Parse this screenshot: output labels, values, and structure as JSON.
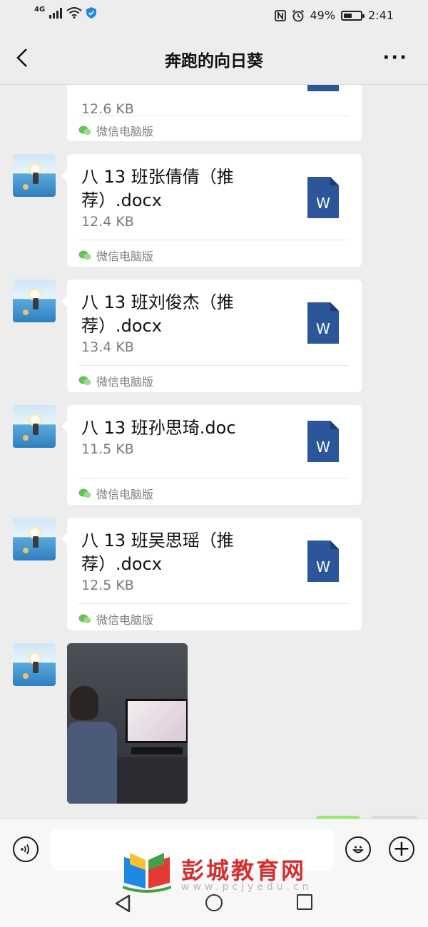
{
  "status_bar": {
    "network": "4G",
    "battery_percent": "49%",
    "time": "2:41",
    "battery_level": 0.49
  },
  "header": {
    "title": "奔跑的向日葵",
    "back_icon": "chevron-left-icon",
    "more_icon": "more-dots-icon",
    "more_label": "···"
  },
  "messages": [
    {
      "type": "file",
      "name": "",
      "size": "12.6 KB",
      "source": "微信电脑版",
      "icon": "word-doc-icon",
      "partial": true
    },
    {
      "type": "file",
      "name": "八 13 班张倩倩（推荐）.docx",
      "size": "12.4 KB",
      "source": "微信电脑版",
      "icon": "word-doc-icon"
    },
    {
      "type": "file",
      "name": "八 13 班刘俊杰（推荐）.docx",
      "size": "13.4 KB",
      "source": "微信电脑版",
      "icon": "word-doc-icon"
    },
    {
      "type": "file",
      "name": "八 13 班孙思琦.doc",
      "size": "11.5 KB",
      "source": "微信电脑版",
      "icon": "word-doc-icon"
    },
    {
      "type": "file",
      "name": "八 13 班吴思瑶（推荐）.docx",
      "size": "12.5 KB",
      "source": "微信电脑版",
      "icon": "word-doc-icon"
    },
    {
      "type": "image",
      "icon": "photo-thumbnail"
    }
  ],
  "input_bar": {
    "voice_icon": "voice-icon",
    "emoji_icon": "emoji-icon",
    "plus_icon": "plus-icon",
    "plus_label": "+"
  },
  "watermark": {
    "name": "彭城教育网",
    "url": "www.pcjyedu.cn"
  },
  "nav_bar": {
    "back_icon": "triangle-back-icon",
    "home_icon": "circle-home-icon",
    "recent_icon": "square-recent-icon"
  }
}
